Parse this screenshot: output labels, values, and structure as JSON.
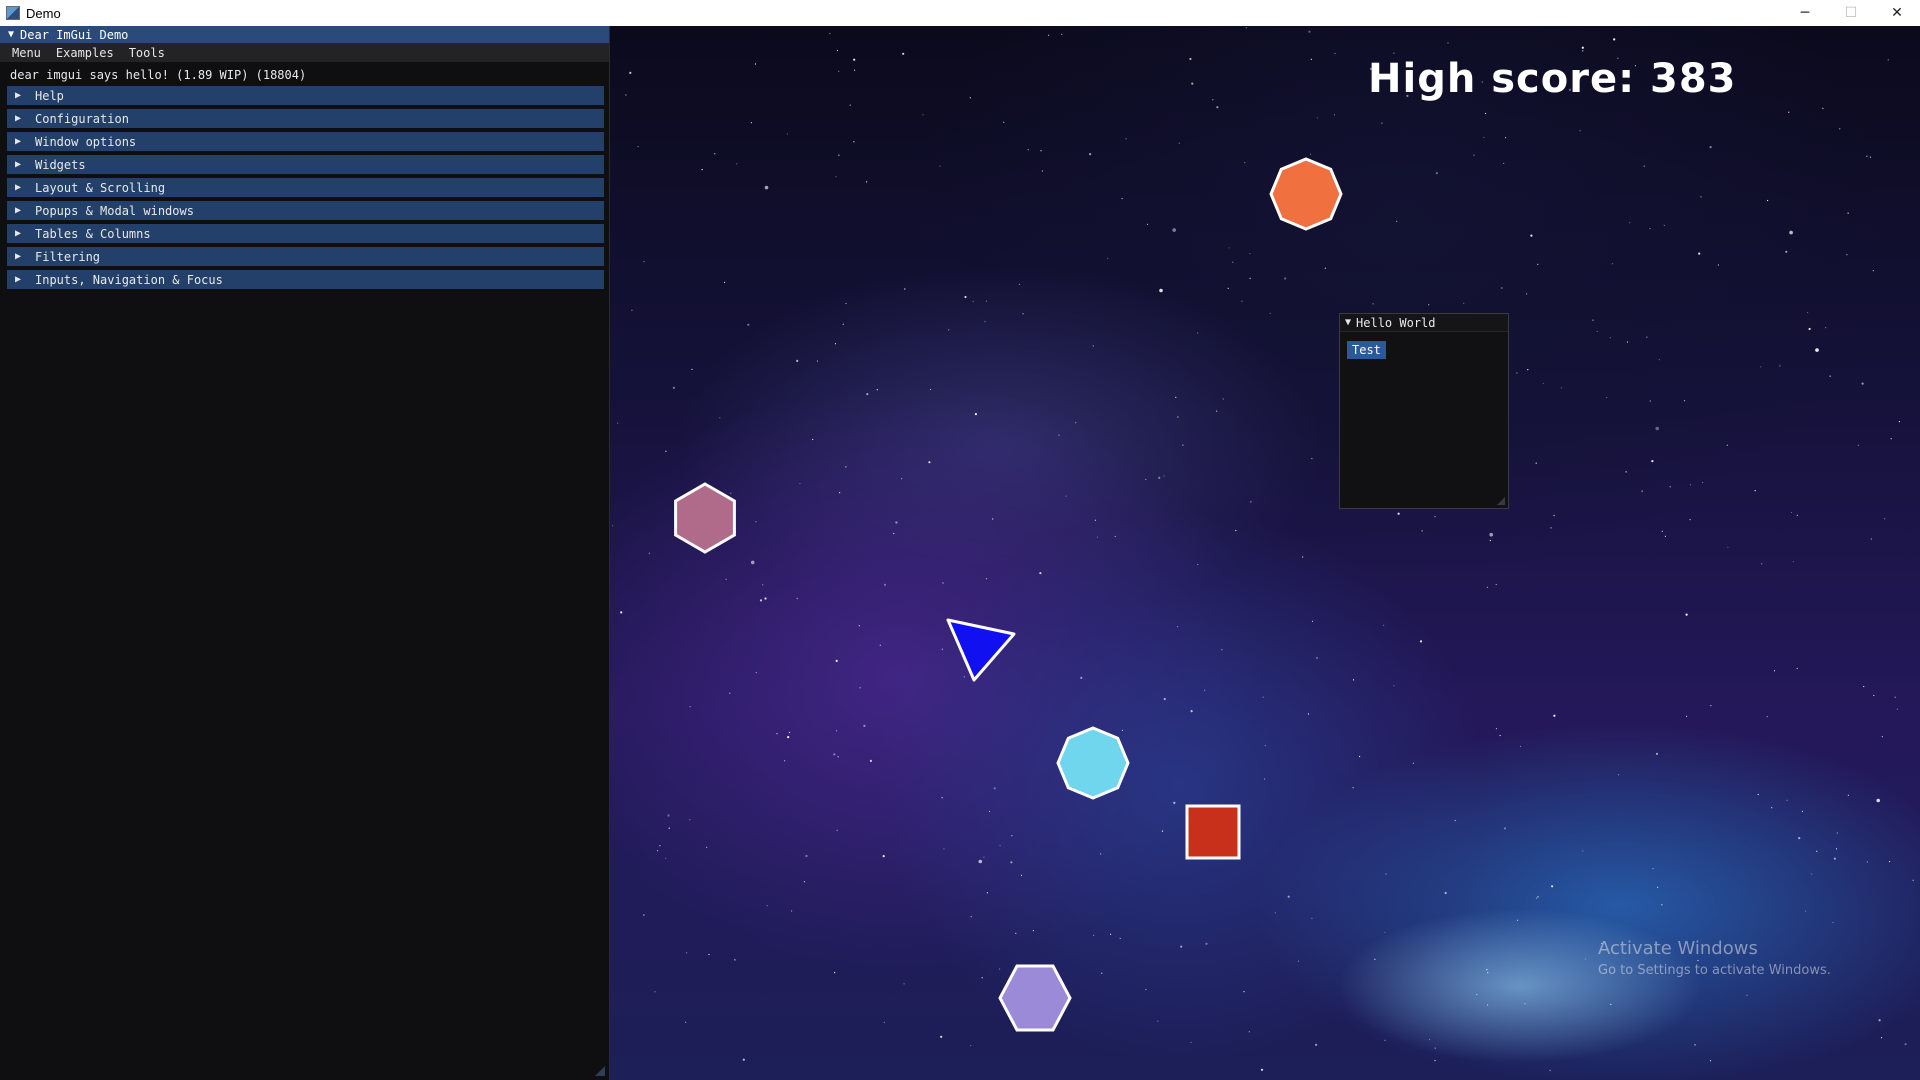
{
  "window": {
    "title": "Demo",
    "controls": {
      "minimize": "─",
      "maximize": "☐",
      "close": "✕"
    }
  },
  "imgui_demo": {
    "title": "Dear ImGui Demo",
    "menu": [
      "Menu",
      "Examples",
      "Tools"
    ],
    "hello_text": "dear imgui says hello! (1.89 WIP) (18804)",
    "sections": [
      "Help",
      "Configuration",
      "Window options",
      "Widgets",
      "Layout & Scrolling",
      "Popups & Modal windows",
      "Tables & Columns",
      "Filtering",
      "Inputs, Navigation & Focus"
    ]
  },
  "game": {
    "high_score_text": "High score: 383",
    "shapes": [
      {
        "name": "orange-octagon",
        "kind": "octagon",
        "color": "#f07040"
      },
      {
        "name": "pink-hexagon",
        "kind": "hexagon",
        "color": "#b06a8a"
      },
      {
        "name": "player-triangle",
        "kind": "triangle",
        "color": "#1010f0"
      },
      {
        "name": "cyan-octagon",
        "kind": "octagon",
        "color": "#6fd6ee"
      },
      {
        "name": "red-square",
        "kind": "square",
        "color": "#c8301c"
      },
      {
        "name": "lavender-hexagon",
        "kind": "hexagon",
        "color": "#9a8ad8"
      }
    ]
  },
  "hello_window": {
    "title": "Hello World",
    "button_label": "Test"
  },
  "watermark": {
    "line1": "Activate Windows",
    "line2": "Go to Settings to activate Windows."
  }
}
